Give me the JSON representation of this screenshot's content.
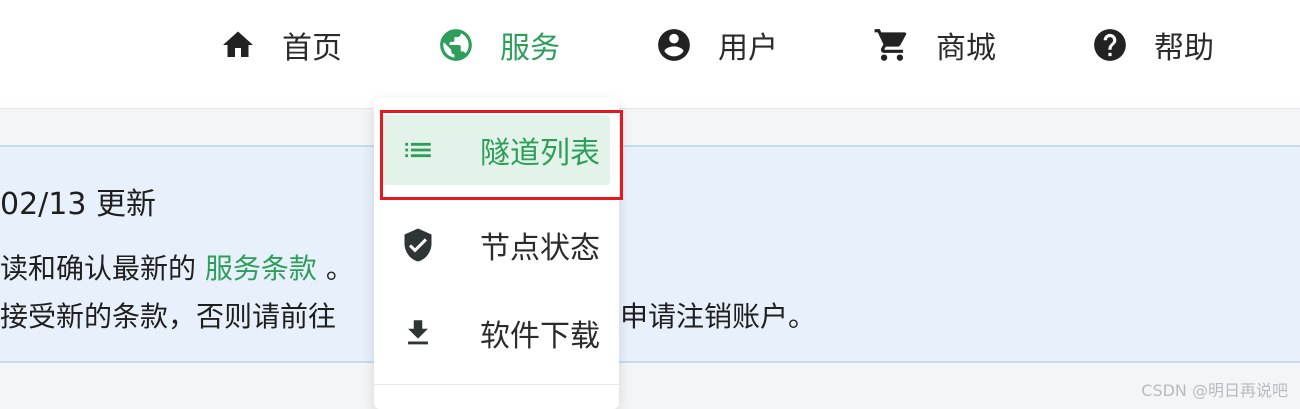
{
  "nav": {
    "items": [
      {
        "label": "首页",
        "icon": "home-icon"
      },
      {
        "label": "服务",
        "icon": "globe-icon"
      },
      {
        "label": "用户",
        "icon": "user-icon"
      },
      {
        "label": "商城",
        "icon": "cart-icon"
      },
      {
        "label": "帮助",
        "icon": "help-icon"
      }
    ],
    "active_index": 1
  },
  "notice": {
    "title": "02/13 更新",
    "line1_prefix": "读和确认最新的",
    "line1_link": "服务条款",
    "line1_suffix": "。",
    "line2_left": "接受新的条款，否则请前往",
    "line2_right": "申请注销账户。"
  },
  "dropdown": {
    "items": [
      {
        "label": "隧道列表",
        "icon": "list-icon"
      },
      {
        "label": "节点状态",
        "icon": "shield-check-icon"
      },
      {
        "label": "软件下载",
        "icon": "download-icon"
      }
    ],
    "active_index": 0
  },
  "watermark": "CSDN @明日再说吧",
  "colors": {
    "accent": "#2e9e5b",
    "highlight": "#e3191c",
    "notice_bg": "#e8f1fb"
  }
}
